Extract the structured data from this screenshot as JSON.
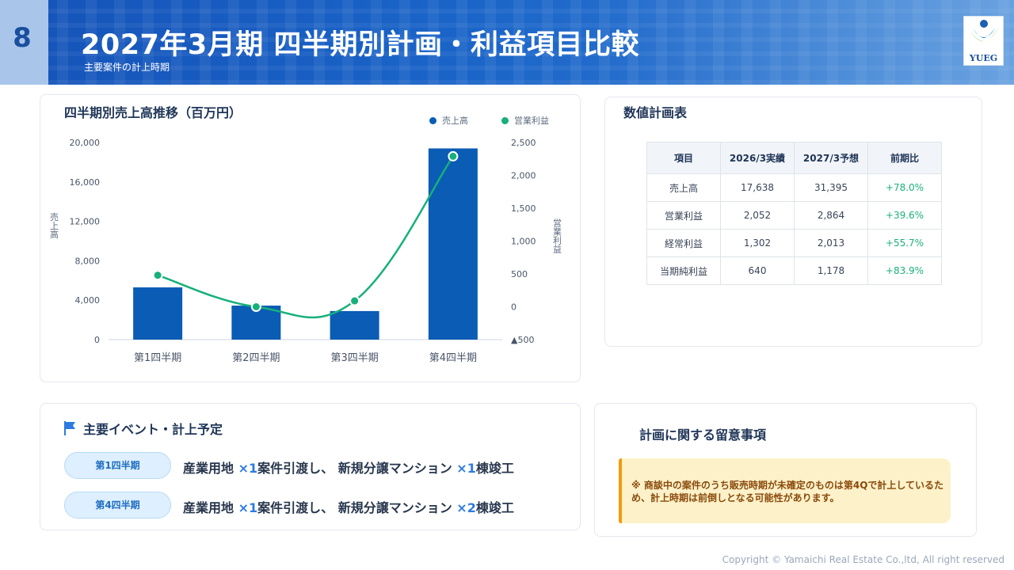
{
  "header": {
    "page_number": "8",
    "title": "2027年3月期 四半期別計画・利益項目比較",
    "subtitle": "主要案件の計上時期",
    "logo_text": "YUEG"
  },
  "chart_panel": {
    "title": "四半期別売上高推移（百万円）",
    "legend": {
      "bar_label": "売上高",
      "line_label": "営業利益"
    }
  },
  "chart_data": {
    "type": "bar",
    "categories": [
      "第1四半期",
      "第2四半期",
      "第3四半期",
      "第4四半期"
    ],
    "series": [
      {
        "name": "売上高",
        "type": "bar",
        "axis": "left",
        "values": [
          5300,
          3450,
          2900,
          19400
        ],
        "color": "#0b5cb5"
      },
      {
        "name": "営業利益",
        "type": "line",
        "axis": "right",
        "values": [
          480,
          0,
          90,
          2290
        ],
        "color": "#17b07a"
      }
    ],
    "ylabel": "売上高",
    "y2label": "営業利益",
    "ylim": [
      0,
      20000
    ],
    "y2lim": [
      -500,
      2500
    ],
    "yticks": [
      "20,000",
      "16,000",
      "12,000",
      "8,000",
      "4,000",
      "0"
    ],
    "y2ticks": [
      "2,500",
      "2,000",
      "1,500",
      "1,000",
      "500",
      "0",
      "▲500"
    ],
    "legend_position": "top-right",
    "grid": false
  },
  "plan_table": {
    "title": "数値計画表",
    "headers": [
      "項目",
      "2026/3実績",
      "2027/3予想",
      "前期比"
    ],
    "rows": [
      [
        "売上高",
        "17,638",
        "31,395",
        "+78.0%"
      ],
      [
        "営業利益",
        "2,052",
        "2,864",
        "+39.6%"
      ],
      [
        "経常利益",
        "1,302",
        "2,013",
        "+55.7%"
      ],
      [
        "当期純利益",
        "640",
        "1,178",
        "+83.9%"
      ]
    ]
  },
  "events": {
    "title": "主要イベント・計上予定",
    "items": [
      {
        "quarter": "第1四半期",
        "p1": "産業用地 ",
        "x1": "×1",
        "p2": "案件引渡し、 新規分譲マンション ",
        "x2": "×1",
        "p3": "棟竣工"
      },
      {
        "quarter": "第4四半期",
        "p1": "産業用地 ",
        "x1": "×1",
        "p2": "案件引渡し、 新規分譲マンション ",
        "x2": "×2",
        "p3": "棟竣工"
      }
    ]
  },
  "notes": {
    "title": "計画に関する留意事項",
    "text": "※ 商談中の案件のうち販売時期が未確定のものは第4Qで計上しているため、計上時期は前倒しとなる可能性があります。"
  },
  "footer": {
    "copyright": "Copyright © Yamaichi Real Estate Co.,ltd, All right reserved"
  }
}
